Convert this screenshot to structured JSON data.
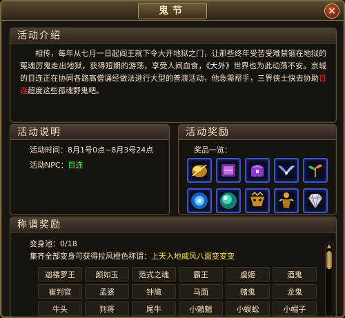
{
  "window": {
    "title": "鬼节",
    "close_label": "×"
  },
  "intro": {
    "header": "活动介绍",
    "text_part1": "相传，每年从七月一日起阎王就下令大开地狱之门，让那些终年受苦受难禁锢在地狱的冤魂厉鬼走出地狱，获得短期的游荡，享受人间血食，",
    "text_book": "《大外》",
    "text_part2": "世界也为此动荡不安。京城的目连正在协同各路高僧诵经做法进行大型的普渡活动，他急需帮手，三界侠士快去协助",
    "text_npc": "目连",
    "text_part3": "超度这些孤魂野鬼吧。"
  },
  "description": {
    "header": "活动说明",
    "time_label": "活动时间：",
    "time_value": "8月1号0点~8月3号24点",
    "npc_label": "活动NPC：",
    "npc_value": "目连"
  },
  "rewards": {
    "header": "活动奖励",
    "caption": "奖品一览：",
    "items": [
      {
        "icon": "golden-orb-icon"
      },
      {
        "icon": "purple-book-icon"
      },
      {
        "icon": "purple-chest-icon"
      },
      {
        "icon": "blue-wings-icon"
      },
      {
        "icon": "green-sprout-icon"
      },
      {
        "icon": "blue-swirl-orb-icon"
      },
      {
        "icon": "green-orb-icon"
      },
      {
        "icon": "golden-mask-icon"
      },
      {
        "icon": "golden-figure-icon"
      },
      {
        "icon": "diamond-icon"
      }
    ]
  },
  "titles": {
    "header": "称谓奖励",
    "pool_label": "变身池：",
    "pool_value": "0/18",
    "collect_label": "集齐全部变身可获得拉风橙色称谓：",
    "collect_reward": "上天入地威风八面变变变",
    "names": [
      "迦楼罗王",
      "颜如玉",
      "范式之魂",
      "霸王",
      "虞姬",
      "酒鬼",
      "崔判官",
      "孟婆",
      "钟馗",
      "马面",
      "赌鬼",
      "龙鬼",
      "牛头",
      "判将",
      "尾牛",
      "小魈魈",
      "小蜈蚣",
      "小帽子"
    ]
  },
  "colors": {
    "accent_gold": "#c9a860",
    "npc_green": "#3cff3c",
    "highlight_red": "#ff2a1a",
    "reward_yellow": "#ffe13c",
    "slot_border": "#3d55c8"
  }
}
